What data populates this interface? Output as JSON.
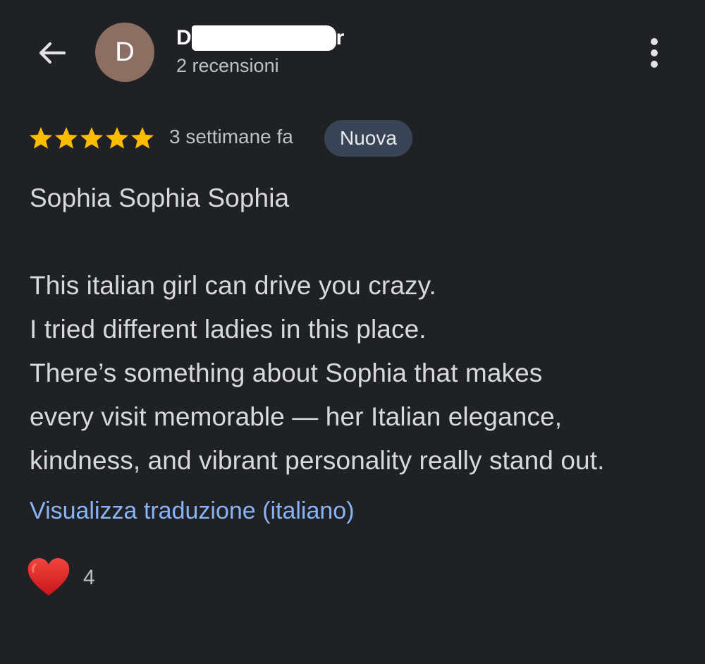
{
  "header": {
    "back_icon": "arrow-left-icon",
    "avatar_letter": "D",
    "avatar_color": "#8d6e63",
    "name_visible_start": "D",
    "name_visible_end": "r",
    "review_count": "2 recensioni",
    "more_icon": "more-vertical-icon"
  },
  "review": {
    "rating": 5,
    "max_rating": 5,
    "star_color": "#fbbc04",
    "time_ago": "3 settimane fa",
    "badge": "Nuova",
    "badge_color": "#394457",
    "paragraphs": [
      "Sophia Sophia Sophia",
      "",
      "This italian girl can drive you crazy.",
      "I tried different ladies in this place.",
      "There’s something about Sophia that makes",
      "every visit memorable — her Italian elegance,",
      "kindness, and vibrant personality really stand out."
    ],
    "translate_link": "Visualizza traduzione (italiano)",
    "translate_link_color": "#8ab4f8",
    "reaction_icon": "heart-icon",
    "reaction_count": "4"
  }
}
